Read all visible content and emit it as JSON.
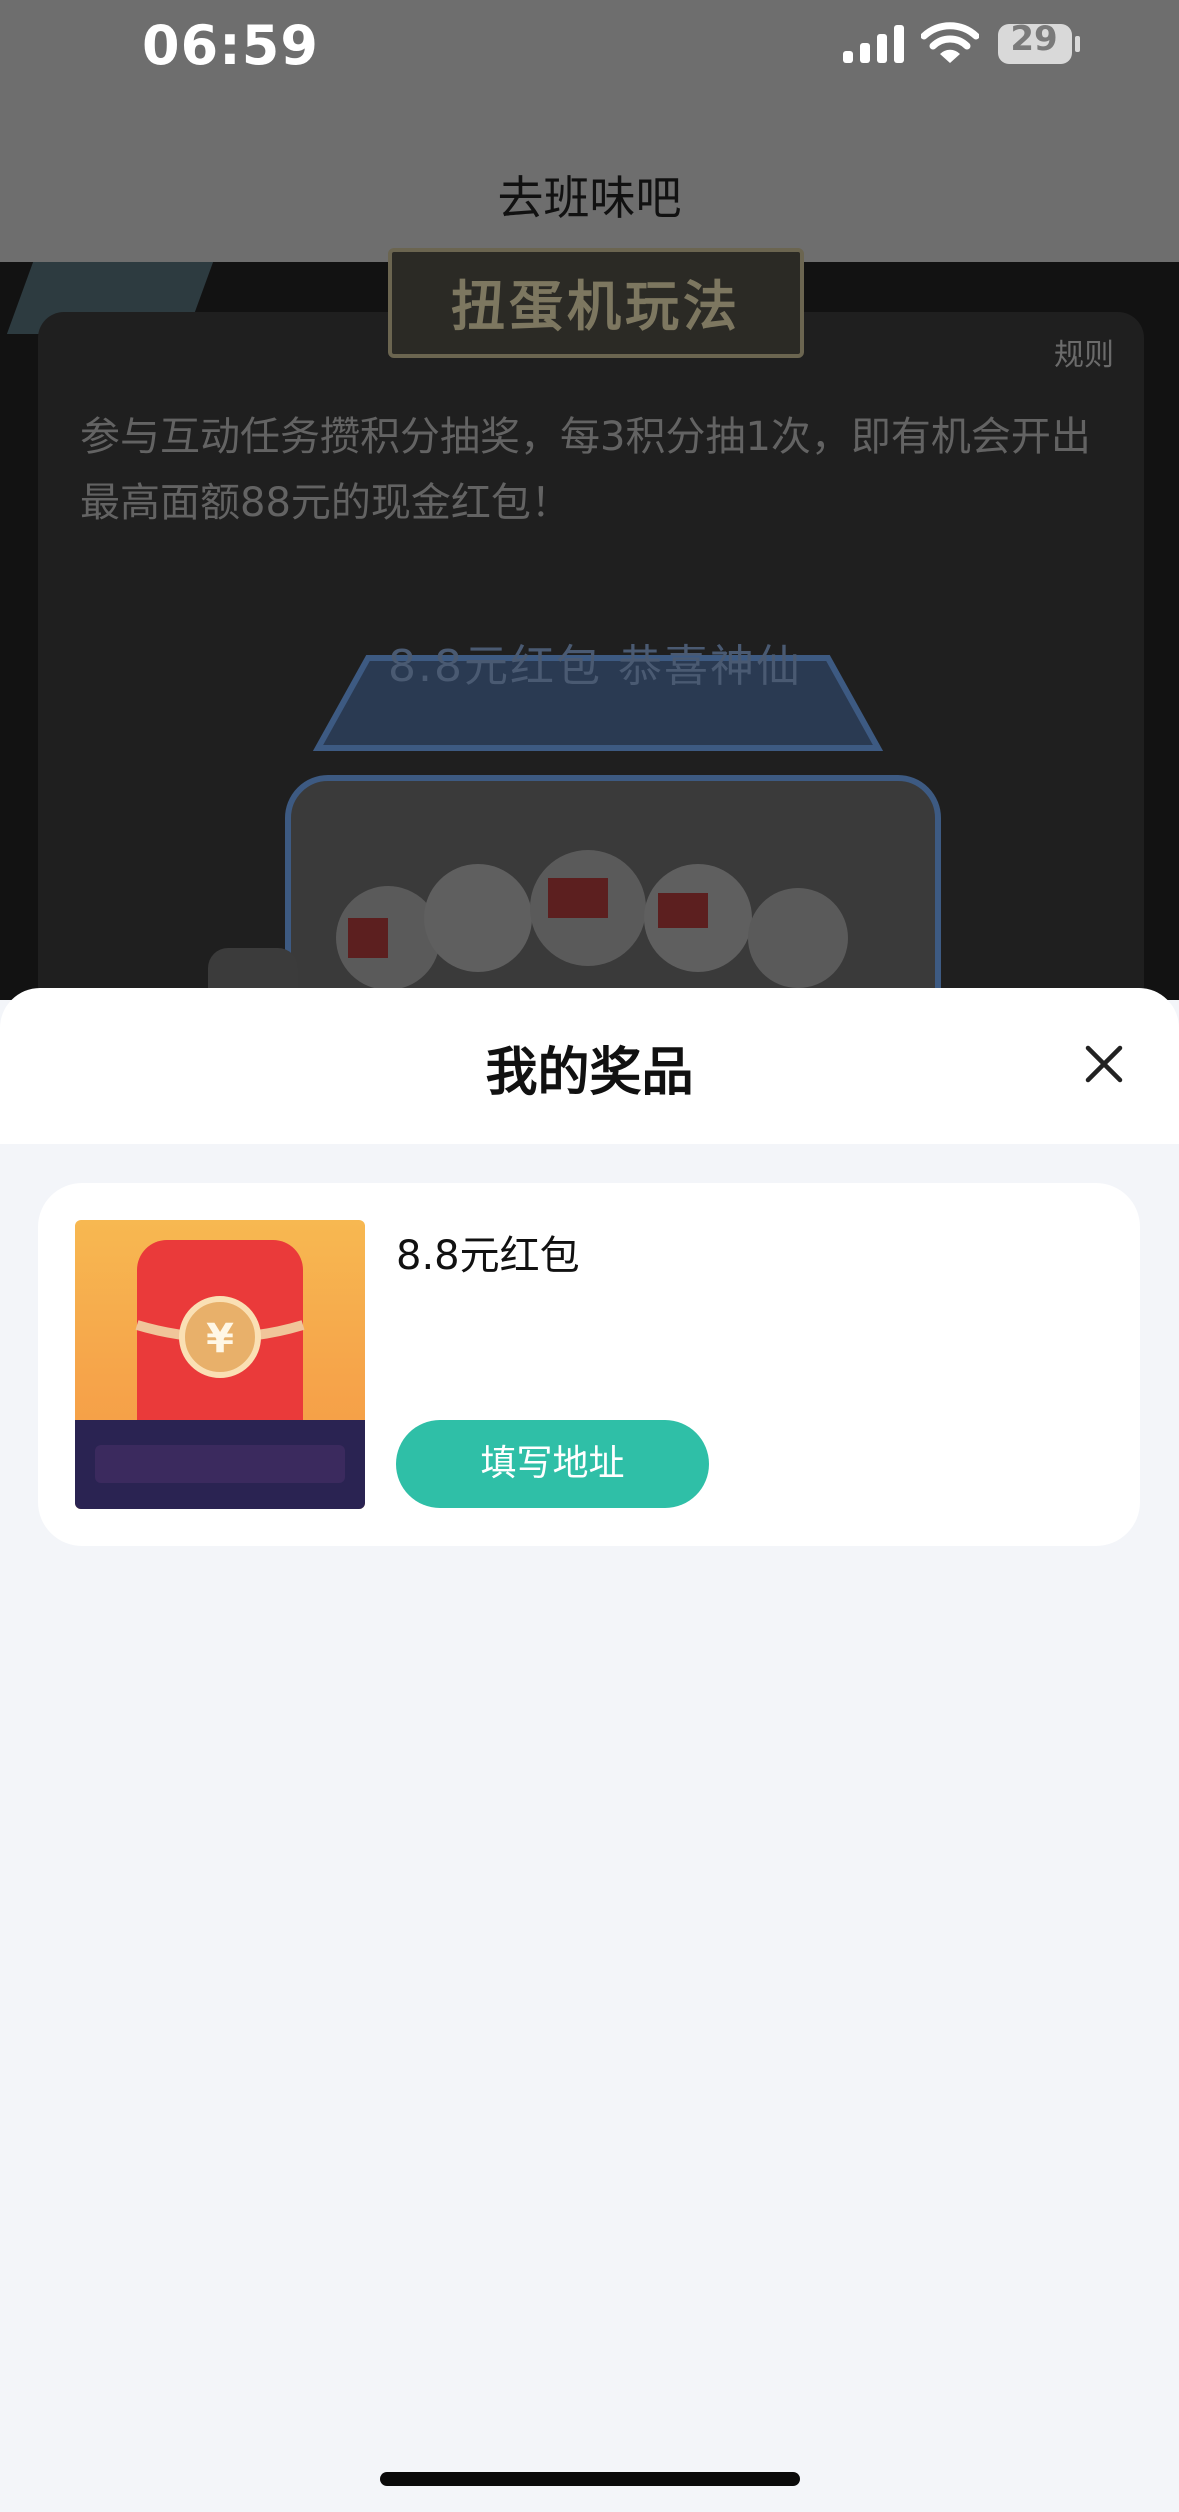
{
  "status_bar": {
    "time": "06:59",
    "battery_level": "29"
  },
  "nav": {
    "title": "去班味吧"
  },
  "background": {
    "banner_title": "扭蛋机玩法",
    "rules_label": "规则",
    "intro": "参与互动任务攒积分抽奖，每3积分抽1次，即有机会开出最高面额88元的现金红包！",
    "machine_label": "8.8元红包  恭喜神仙"
  },
  "sheet": {
    "title": "我的奖品",
    "prizes": [
      {
        "name": "8.8元红包",
        "action_label": "填写地址",
        "image_icon": "red-envelope-icon"
      }
    ]
  },
  "colors": {
    "accent": "#2fbfa7",
    "sheet_bg": "#f3f5f9",
    "overlay": "#6e6e6e"
  }
}
